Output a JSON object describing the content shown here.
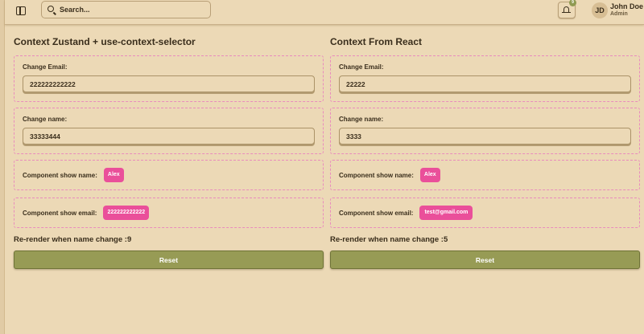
{
  "header": {
    "search_placeholder": "Search...",
    "notification_count": "9",
    "avatar_initials": "JD",
    "user_name": "John Doe",
    "user_role": "Admin"
  },
  "left": {
    "title": "Context Zustand + use-context-selector",
    "email_label": "Change Email:",
    "email_value": "222222222222",
    "name_label": "Change name:",
    "name_value": "33333444",
    "show_name_label": "Component show name:",
    "show_name_value": "Alex",
    "show_email_label": "Component show email:",
    "show_email_value": "222222222222",
    "rerender_text": "Re-render when name change :9",
    "reset_label": "Reset"
  },
  "right": {
    "title": "Context From React",
    "email_label": "Change Email:",
    "email_value": "22222",
    "name_label": "Change name:",
    "name_value": "3333",
    "show_name_label": "Component show name:",
    "show_name_value": "Alex",
    "show_email_label": "Component show email:",
    "show_email_value": "test@gmail.com",
    "rerender_text": "Re-render when name change :5",
    "reset_label": "Reset"
  },
  "colors": {
    "background": "#ecd9b6",
    "accent_pill": "#ea4f9a",
    "button": "#979b55",
    "dashed_border": "#e98bbd"
  }
}
